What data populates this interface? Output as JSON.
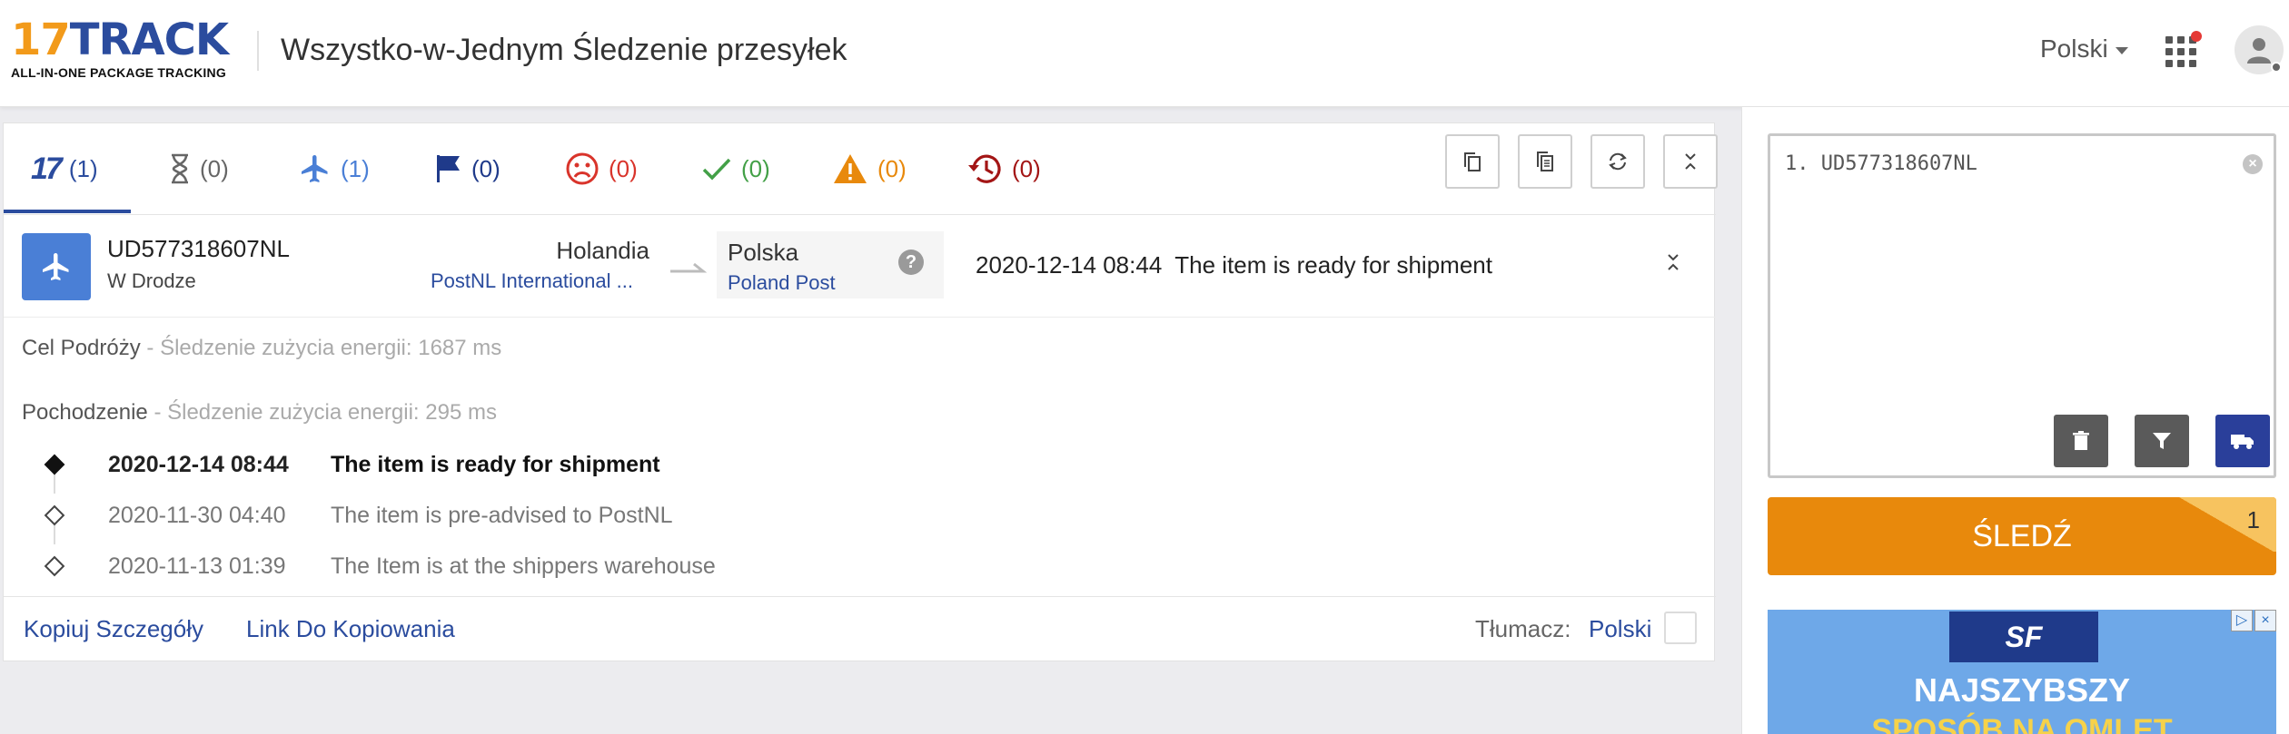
{
  "header": {
    "logo_main": "17TRACK",
    "logo_sub": "ALL-IN-ONE PACKAGE TRACKING",
    "title": "Wszystko-w-Jednym Śledzenie przesyłek",
    "language": "Polski"
  },
  "tabs": [
    {
      "name": "tab-all",
      "icon": "17-logo-icon",
      "count": "(1)",
      "color": "#2b4c9e"
    },
    {
      "name": "tab-not-found",
      "icon": "hourglass-icon",
      "count": "(0)",
      "color": "#666666"
    },
    {
      "name": "tab-in-transit",
      "icon": "airplane-icon",
      "count": "(1)",
      "color": "#4a7fd6"
    },
    {
      "name": "tab-pickup",
      "icon": "flag-icon",
      "count": "(0)",
      "color": "#1f3a8a"
    },
    {
      "name": "tab-undelivered",
      "icon": "sad-face-icon",
      "count": "(0)",
      "color": "#d9342b"
    },
    {
      "name": "tab-delivered",
      "icon": "checkmark-icon",
      "count": "(0)",
      "color": "#43a047"
    },
    {
      "name": "tab-alert",
      "icon": "warning-icon",
      "count": "(0)",
      "color": "#e8890c"
    },
    {
      "name": "tab-expired",
      "icon": "history-icon",
      "count": "(0)",
      "color": "#a31515"
    }
  ],
  "shipment": {
    "tracking_number": "UD577318607NL",
    "status": "W Drodze",
    "origin_country": "Holandia",
    "origin_carrier": "PostNL International ...",
    "dest_country": "Polska",
    "dest_carrier": "Poland Post",
    "latest_date": "2020-12-14 08:44",
    "latest_desc": "The item is ready for shipment",
    "destination_label": "Cel Podróży",
    "destination_info": " - Śledzenie zużycia energii: 1687 ms",
    "origin_label": "Pochodzenie",
    "origin_info": " - Śledzenie zużycia energii: 295 ms",
    "events": [
      {
        "date": "2020-12-14 08:44",
        "desc": "The item is ready for shipment"
      },
      {
        "date": "2020-11-30 04:40",
        "desc": "The item is pre-advised to PostNL"
      },
      {
        "date": "2020-11-13 01:39",
        "desc": "The Item is at the shippers warehouse"
      }
    ]
  },
  "footer": {
    "copy_details": "Kopiuj Szczegóły",
    "copy_link": "Link Do Kopiowania",
    "translator_label": "Tłumacz:",
    "translator_lang": "Polski"
  },
  "sidebar": {
    "input_value": "1. UD577318607NL",
    "track_button": "ŚLEDŹ",
    "track_count": "1"
  },
  "ad": {
    "logo": "SF",
    "headline": "NAJSZYBSZY",
    "subline": "SPOSÓB NA OMLET"
  },
  "colors": {
    "brand_blue": "#2b4c9e",
    "brand_orange": "#e8890c"
  }
}
